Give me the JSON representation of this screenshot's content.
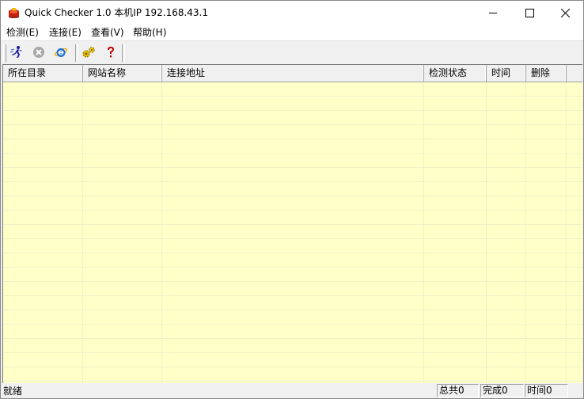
{
  "window": {
    "title": "Quick Checker 1.0  本机IP 192.168.43.1"
  },
  "menu": {
    "items": [
      "检测(E)",
      "连接(E)",
      "查看(V)",
      "帮助(H)"
    ]
  },
  "toolbar": {
    "buttons": [
      "start-check",
      "stop",
      "internet-explorer",
      "settings",
      "help"
    ]
  },
  "table": {
    "columns": [
      "所在目录",
      "网站名称",
      "连接地址",
      "检测状态",
      "时间",
      "删除"
    ],
    "rows": []
  },
  "status": {
    "text": "就绪",
    "total": "总共0",
    "done": "完成0",
    "time": "时间0"
  },
  "colors": {
    "list_background": "#ffffc8",
    "grid_line": "#f0f0c4"
  }
}
